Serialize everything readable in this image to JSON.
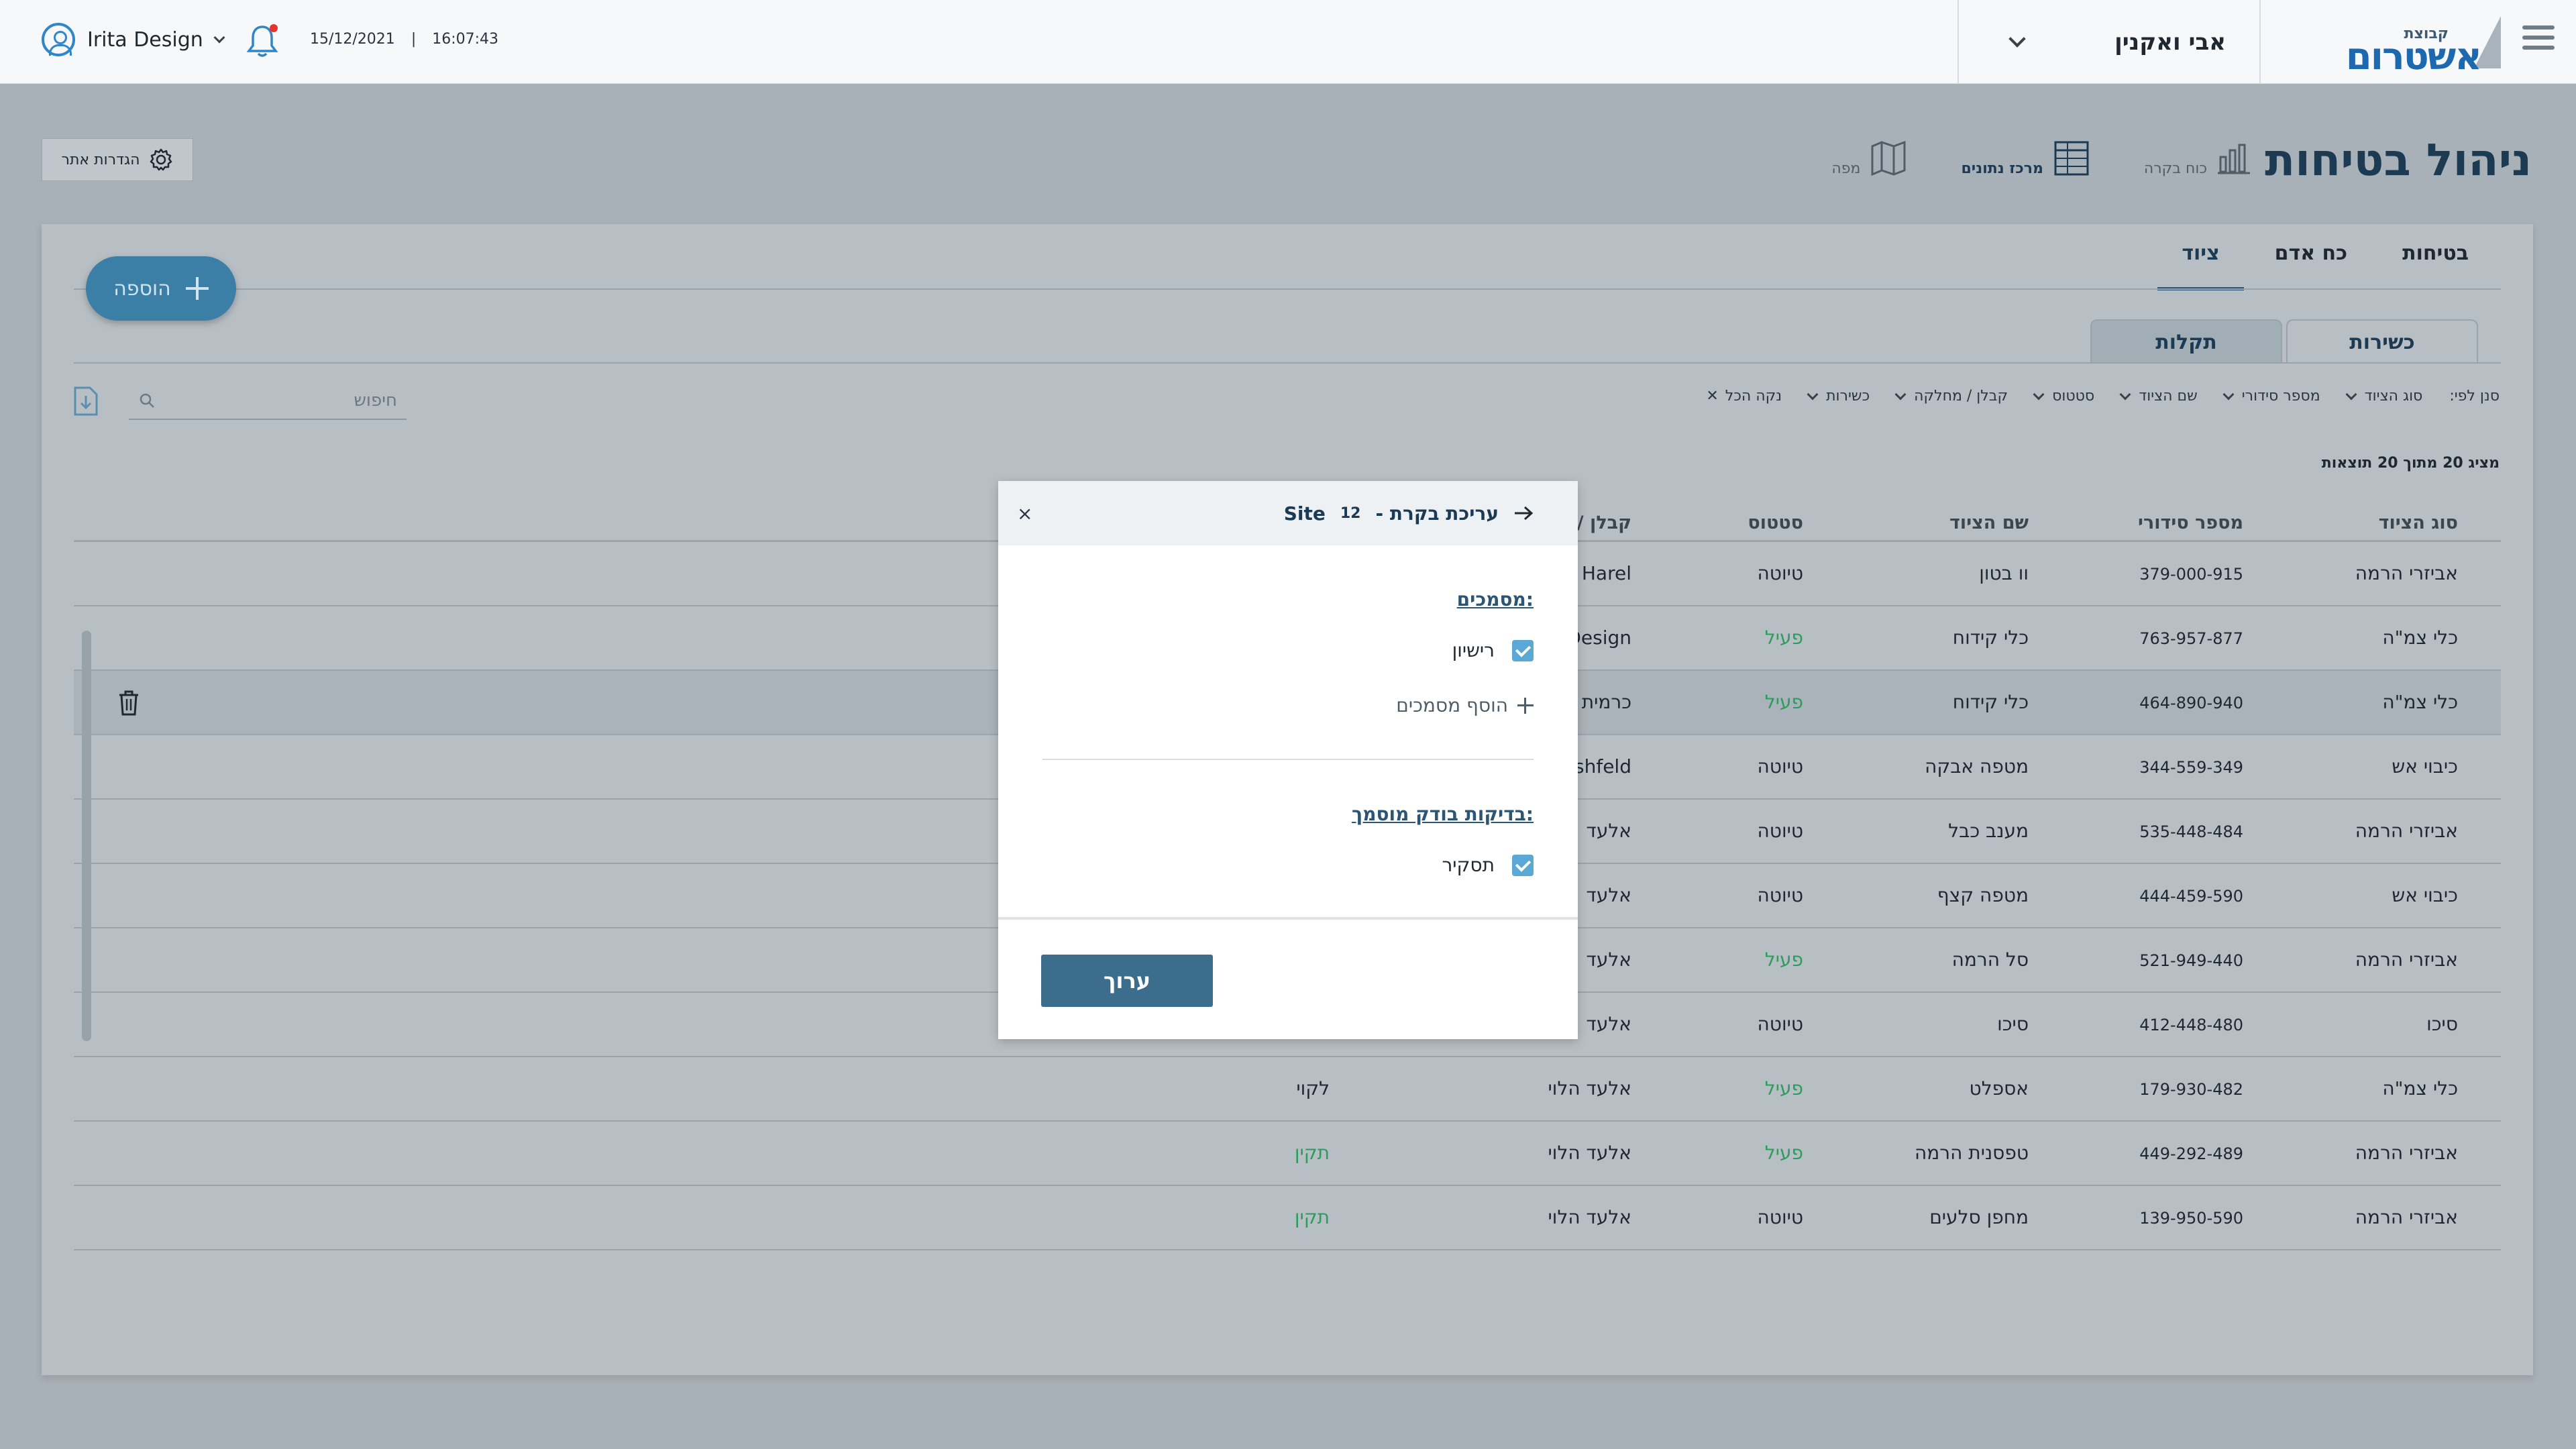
{
  "topbar": {
    "user_name": "Irita Design",
    "date": "15/12/2021",
    "separator": "|",
    "time": "16:07:43",
    "project_name": "אבי ואקנין",
    "logo_small": "קבוצת",
    "logo_main": "אשטרום"
  },
  "header": {
    "page_title": "ניהול בטיחות",
    "links": [
      {
        "label": "כוח בקרה",
        "icon": "bar-chart-icon"
      },
      {
        "label": "מרכז נתונים",
        "icon": "spreadsheet-icon"
      },
      {
        "label": "מפה",
        "icon": "map-icon"
      }
    ],
    "site_settings_label": "הגדרות אתר"
  },
  "tabs": [
    "בטיחות",
    "כח אדם",
    "ציוד"
  ],
  "add_button_label": "הוספה",
  "subtabs": [
    "כשירות",
    "תקלות"
  ],
  "filters": {
    "prefix": "סנן לפי:",
    "items": [
      "סוג הציוד",
      "מספר סידורי",
      "שם הציוד",
      "סטטוס",
      "קבלן / מחלקה",
      "כשירות"
    ],
    "clear_all": "נקה הכל"
  },
  "search": {
    "placeholder": "חיפוש"
  },
  "results_text": "מציג 20 מתוך 20 תוצאות",
  "table": {
    "columns": [
      "סוג הציוד",
      "מספר סידורי",
      "שם הציוד",
      "סטטוס",
      "קבלן / מחלקה"
    ],
    "rows": [
      {
        "type": "אביזרי הרמה",
        "serial": "379-000-915",
        "name": "וו בטון",
        "status": "טיוטה",
        "contractor": "Harel",
        "fitness": ""
      },
      {
        "type": "כלי צמ\"ה",
        "serial": "763-957-877",
        "name": "כלי קידוח",
        "status": "פעיל",
        "contractor": "Design",
        "fitness": ""
      },
      {
        "type": "כלי צמ\"ה",
        "serial": "464-890-940",
        "name": "כלי קידוח",
        "status": "פעיל",
        "contractor": "כרמית",
        "fitness": ""
      },
      {
        "type": "כיבוי אש",
        "serial": "344-559-349",
        "name": "מטפה אבקה",
        "status": "טיוטה",
        "contractor": "shfeld",
        "fitness": ""
      },
      {
        "type": "אביזרי הרמה",
        "serial": "535-448-484",
        "name": "מענב כבל",
        "status": "טיוטה",
        "contractor": "אלעד",
        "fitness": ""
      },
      {
        "type": "כיבוי אש",
        "serial": "444-459-590",
        "name": "מטפה קצף",
        "status": "טיוטה",
        "contractor": "אלעד",
        "fitness": ""
      },
      {
        "type": "אביזרי הרמה",
        "serial": "521-949-440",
        "name": "סל הרמה",
        "status": "פעיל",
        "contractor": "אלעד",
        "fitness": ""
      },
      {
        "type": "סיכו",
        "serial": "412-448-480",
        "name": "סיכו",
        "status": "טיוטה",
        "contractor": "אלעד",
        "fitness": ""
      },
      {
        "type": "כלי צמ\"ה",
        "serial": "179-930-482",
        "name": "אספלט",
        "status": "פעיל",
        "contractor": "אלעד הלוי",
        "fitness": "לקוי"
      },
      {
        "type": "אביזרי הרמה",
        "serial": "449-292-489",
        "name": "טפסנית הרמה",
        "status": "פעיל",
        "contractor": "אלעד הלוי",
        "fitness": "תקין"
      },
      {
        "type": "אביזרי הרמה",
        "serial": "139-950-590",
        "name": "מחפן סלעים",
        "status": "טיוטה",
        "contractor": "אלעד הלוי",
        "fitness": "תקין"
      }
    ]
  },
  "modal": {
    "title": "עריכת בקרת -",
    "site_label": "Site",
    "site_number": "12",
    "documents_title": "מסמכים:",
    "documents": [
      {
        "label": "רישיון",
        "checked": true
      }
    ],
    "add_documents": "הוסף מסמכים",
    "inspections_title": "בדיקות בודק מוסמך:",
    "inspections": [
      {
        "label": "תסקיר",
        "checked": true
      }
    ],
    "edit_button": "ערוך",
    "close": "×"
  },
  "colors": {
    "accent": "#2c5573",
    "brand_blue": "#1d69b0",
    "active_green": "#2a9d5c",
    "overlay_bg": "#a8b1b7",
    "checkbox": "#5aa8d6"
  }
}
